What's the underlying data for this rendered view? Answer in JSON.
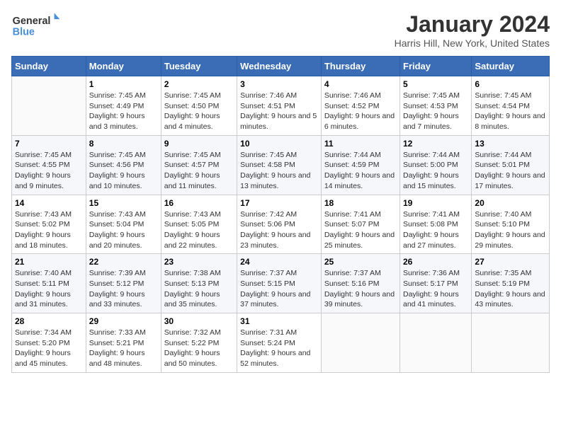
{
  "header": {
    "logo_line1": "General",
    "logo_line2": "Blue",
    "month_title": "January 2024",
    "location": "Harris Hill, New York, United States"
  },
  "days_of_week": [
    "Sunday",
    "Monday",
    "Tuesday",
    "Wednesday",
    "Thursday",
    "Friday",
    "Saturday"
  ],
  "weeks": [
    [
      {
        "day": "",
        "sunrise": "",
        "sunset": "",
        "daylight": ""
      },
      {
        "day": "1",
        "sunrise": "Sunrise: 7:45 AM",
        "sunset": "Sunset: 4:49 PM",
        "daylight": "Daylight: 9 hours and 3 minutes."
      },
      {
        "day": "2",
        "sunrise": "Sunrise: 7:45 AM",
        "sunset": "Sunset: 4:50 PM",
        "daylight": "Daylight: 9 hours and 4 minutes."
      },
      {
        "day": "3",
        "sunrise": "Sunrise: 7:46 AM",
        "sunset": "Sunset: 4:51 PM",
        "daylight": "Daylight: 9 hours and 5 minutes."
      },
      {
        "day": "4",
        "sunrise": "Sunrise: 7:46 AM",
        "sunset": "Sunset: 4:52 PM",
        "daylight": "Daylight: 9 hours and 6 minutes."
      },
      {
        "day": "5",
        "sunrise": "Sunrise: 7:45 AM",
        "sunset": "Sunset: 4:53 PM",
        "daylight": "Daylight: 9 hours and 7 minutes."
      },
      {
        "day": "6",
        "sunrise": "Sunrise: 7:45 AM",
        "sunset": "Sunset: 4:54 PM",
        "daylight": "Daylight: 9 hours and 8 minutes."
      }
    ],
    [
      {
        "day": "7",
        "sunrise": "Sunrise: 7:45 AM",
        "sunset": "Sunset: 4:55 PM",
        "daylight": "Daylight: 9 hours and 9 minutes."
      },
      {
        "day": "8",
        "sunrise": "Sunrise: 7:45 AM",
        "sunset": "Sunset: 4:56 PM",
        "daylight": "Daylight: 9 hours and 10 minutes."
      },
      {
        "day": "9",
        "sunrise": "Sunrise: 7:45 AM",
        "sunset": "Sunset: 4:57 PM",
        "daylight": "Daylight: 9 hours and 11 minutes."
      },
      {
        "day": "10",
        "sunrise": "Sunrise: 7:45 AM",
        "sunset": "Sunset: 4:58 PM",
        "daylight": "Daylight: 9 hours and 13 minutes."
      },
      {
        "day": "11",
        "sunrise": "Sunrise: 7:44 AM",
        "sunset": "Sunset: 4:59 PM",
        "daylight": "Daylight: 9 hours and 14 minutes."
      },
      {
        "day": "12",
        "sunrise": "Sunrise: 7:44 AM",
        "sunset": "Sunset: 5:00 PM",
        "daylight": "Daylight: 9 hours and 15 minutes."
      },
      {
        "day": "13",
        "sunrise": "Sunrise: 7:44 AM",
        "sunset": "Sunset: 5:01 PM",
        "daylight": "Daylight: 9 hours and 17 minutes."
      }
    ],
    [
      {
        "day": "14",
        "sunrise": "Sunrise: 7:43 AM",
        "sunset": "Sunset: 5:02 PM",
        "daylight": "Daylight: 9 hours and 18 minutes."
      },
      {
        "day": "15",
        "sunrise": "Sunrise: 7:43 AM",
        "sunset": "Sunset: 5:04 PM",
        "daylight": "Daylight: 9 hours and 20 minutes."
      },
      {
        "day": "16",
        "sunrise": "Sunrise: 7:43 AM",
        "sunset": "Sunset: 5:05 PM",
        "daylight": "Daylight: 9 hours and 22 minutes."
      },
      {
        "day": "17",
        "sunrise": "Sunrise: 7:42 AM",
        "sunset": "Sunset: 5:06 PM",
        "daylight": "Daylight: 9 hours and 23 minutes."
      },
      {
        "day": "18",
        "sunrise": "Sunrise: 7:41 AM",
        "sunset": "Sunset: 5:07 PM",
        "daylight": "Daylight: 9 hours and 25 minutes."
      },
      {
        "day": "19",
        "sunrise": "Sunrise: 7:41 AM",
        "sunset": "Sunset: 5:08 PM",
        "daylight": "Daylight: 9 hours and 27 minutes."
      },
      {
        "day": "20",
        "sunrise": "Sunrise: 7:40 AM",
        "sunset": "Sunset: 5:10 PM",
        "daylight": "Daylight: 9 hours and 29 minutes."
      }
    ],
    [
      {
        "day": "21",
        "sunrise": "Sunrise: 7:40 AM",
        "sunset": "Sunset: 5:11 PM",
        "daylight": "Daylight: 9 hours and 31 minutes."
      },
      {
        "day": "22",
        "sunrise": "Sunrise: 7:39 AM",
        "sunset": "Sunset: 5:12 PM",
        "daylight": "Daylight: 9 hours and 33 minutes."
      },
      {
        "day": "23",
        "sunrise": "Sunrise: 7:38 AM",
        "sunset": "Sunset: 5:13 PM",
        "daylight": "Daylight: 9 hours and 35 minutes."
      },
      {
        "day": "24",
        "sunrise": "Sunrise: 7:37 AM",
        "sunset": "Sunset: 5:15 PM",
        "daylight": "Daylight: 9 hours and 37 minutes."
      },
      {
        "day": "25",
        "sunrise": "Sunrise: 7:37 AM",
        "sunset": "Sunset: 5:16 PM",
        "daylight": "Daylight: 9 hours and 39 minutes."
      },
      {
        "day": "26",
        "sunrise": "Sunrise: 7:36 AM",
        "sunset": "Sunset: 5:17 PM",
        "daylight": "Daylight: 9 hours and 41 minutes."
      },
      {
        "day": "27",
        "sunrise": "Sunrise: 7:35 AM",
        "sunset": "Sunset: 5:19 PM",
        "daylight": "Daylight: 9 hours and 43 minutes."
      }
    ],
    [
      {
        "day": "28",
        "sunrise": "Sunrise: 7:34 AM",
        "sunset": "Sunset: 5:20 PM",
        "daylight": "Daylight: 9 hours and 45 minutes."
      },
      {
        "day": "29",
        "sunrise": "Sunrise: 7:33 AM",
        "sunset": "Sunset: 5:21 PM",
        "daylight": "Daylight: 9 hours and 48 minutes."
      },
      {
        "day": "30",
        "sunrise": "Sunrise: 7:32 AM",
        "sunset": "Sunset: 5:22 PM",
        "daylight": "Daylight: 9 hours and 50 minutes."
      },
      {
        "day": "31",
        "sunrise": "Sunrise: 7:31 AM",
        "sunset": "Sunset: 5:24 PM",
        "daylight": "Daylight: 9 hours and 52 minutes."
      },
      {
        "day": "",
        "sunrise": "",
        "sunset": "",
        "daylight": ""
      },
      {
        "day": "",
        "sunrise": "",
        "sunset": "",
        "daylight": ""
      },
      {
        "day": "",
        "sunrise": "",
        "sunset": "",
        "daylight": ""
      }
    ]
  ]
}
